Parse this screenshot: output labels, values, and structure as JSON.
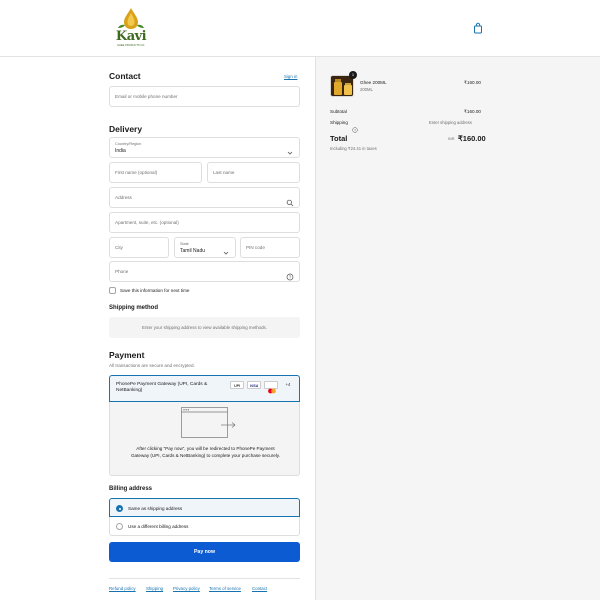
{
  "header": {
    "logo_text": "Kavi",
    "logo_subtitle": "GHEE PRODUCTS CO."
  },
  "contact": {
    "heading": "Contact",
    "sign_in": "Sign in",
    "email_placeholder": "Email or mobile phone number"
  },
  "delivery": {
    "heading": "Delivery",
    "country_label": "Country/Region",
    "country_value": "India",
    "first_name_placeholder": "First name (optional)",
    "last_name_placeholder": "Last name",
    "address_placeholder": "Address",
    "apartment_placeholder": "Apartment, suite, etc. (optional)",
    "city_placeholder": "City",
    "state_label": "State",
    "state_value": "Tamil Nadu",
    "pin_placeholder": "PIN code",
    "phone_placeholder": "Phone",
    "save_info_label": "Save this information for next time"
  },
  "shipping": {
    "heading": "Shipping method",
    "message": "Enter your shipping address to view available shipping methods."
  },
  "payment": {
    "heading": "Payment",
    "subtitle": "All transactions are secure and encrypted.",
    "option_name": "PhonePe Payment Gateway (UPI, Cards & NetBanking)",
    "badges": [
      "UPI",
      "VISA",
      "+4"
    ],
    "redirect_text": "After clicking “Pay now”, you will be redirected to PhonePe Payment Gateway (UPI, Cards & NetBanking) to complete your purchase securely."
  },
  "billing": {
    "heading": "Billing address",
    "option_same": "Same as shipping address",
    "option_different": "Use a different billing address"
  },
  "pay_button": "Pay now",
  "footer_links": [
    "Refund policy",
    "Shipping",
    "Privacy policy",
    "Terms of service",
    "Contact"
  ],
  "summary": {
    "product_name": "Ghee 200ML",
    "product_variant": "200ML",
    "quantity": "1",
    "product_price": "₹160.00",
    "subtotal_label": "Subtotal",
    "subtotal_value": "₹160.00",
    "shipping_label": "Shipping",
    "shipping_value": "Enter shipping address",
    "total_label": "Total",
    "currency": "INR",
    "total_value": "₹160.00",
    "taxes_note": "Including ₹24.41 in taxes"
  },
  "colors": {
    "accent": "#0c5bd3",
    "link": "#1773b0",
    "brand_green": "#3e6a1f"
  }
}
